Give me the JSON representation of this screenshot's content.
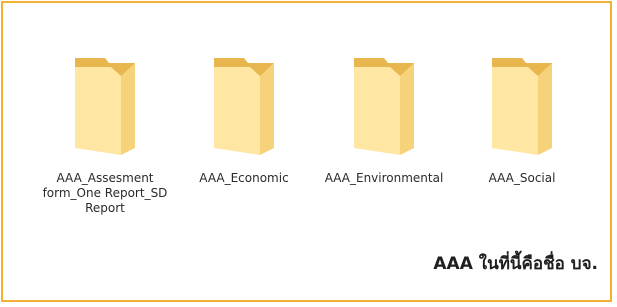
{
  "folders": [
    {
      "name": "AAA_Assesment form_One Report_SD Report"
    },
    {
      "name": "AAA_Economic"
    },
    {
      "name": "AAA_Environmental"
    },
    {
      "name": "AAA_Social"
    }
  ],
  "annotation": {
    "text": "AAA ในที่นี้คือชื่อ บจ."
  },
  "colors": {
    "frame_border": "#f2b134",
    "folder_body": "#f6d27a",
    "folder_front": "#ffe7a3",
    "folder_tab": "#e8b64e"
  }
}
